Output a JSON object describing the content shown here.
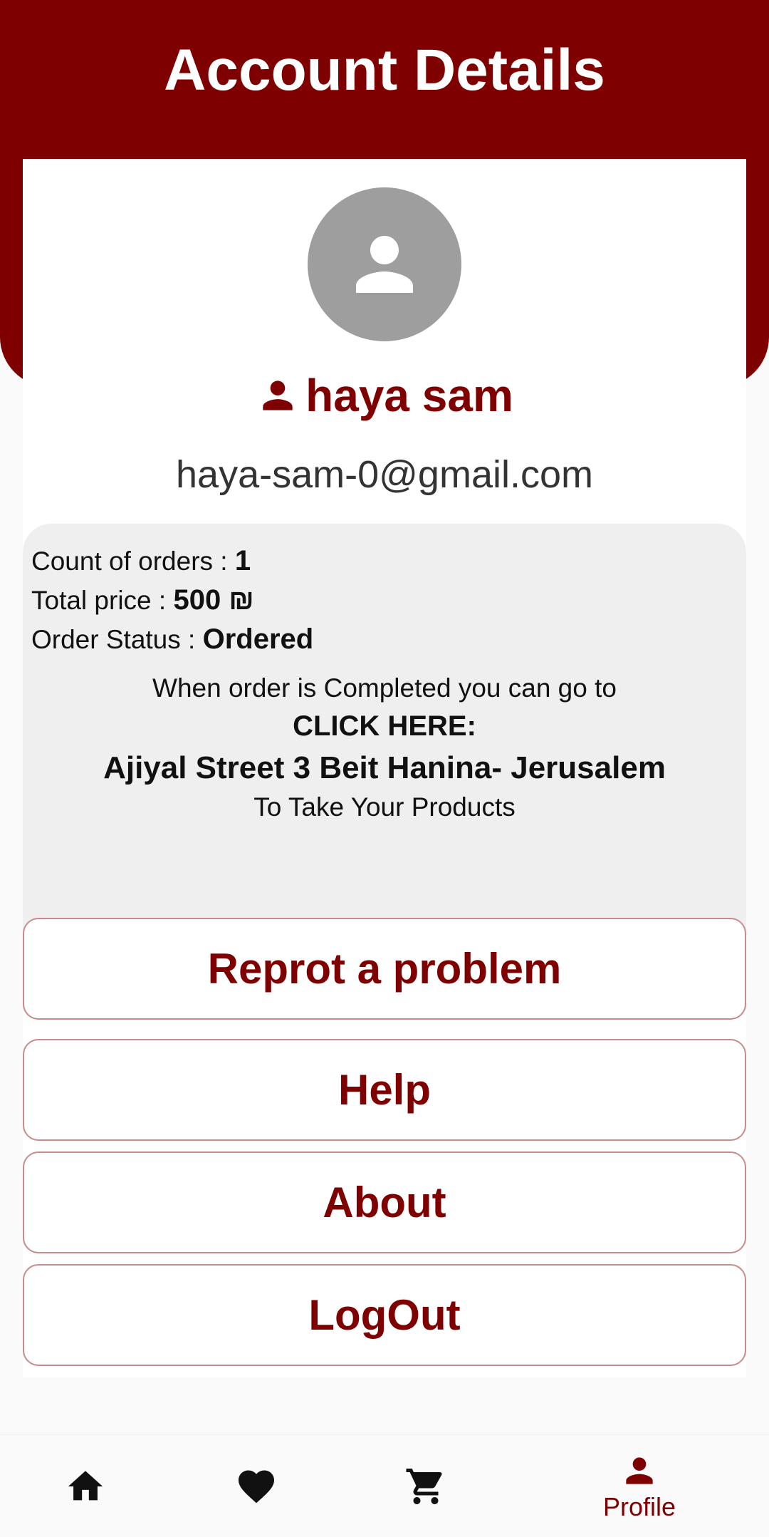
{
  "header": {
    "title": "Account Details"
  },
  "profile": {
    "name": "haya sam",
    "email": "haya-sam-0@gmail.com"
  },
  "orders": {
    "count_label": "Count of orders : ",
    "count_value": "1",
    "total_label": "Total price : ",
    "total_value": "500 ₪",
    "status_label": "Order Status : ",
    "status_value": "Ordered"
  },
  "pickup": {
    "intro": "When order is Completed you can go to",
    "click": "CLICK HERE:",
    "address": "Ajiyal Street 3 Beit Hanina- Jerusalem",
    "outro": "To Take Your Products"
  },
  "actions": {
    "report": "Reprot a problem",
    "help": "Help",
    "about": "About",
    "logout": "LogOut"
  },
  "nav": {
    "profile_label": "Profile"
  },
  "colors": {
    "brand": "#7e0000",
    "avatar_bg": "#9e9e9e",
    "info_bg": "#efefef"
  },
  "icons": [
    "person-icon",
    "home-icon",
    "heart-icon",
    "cart-icon"
  ]
}
